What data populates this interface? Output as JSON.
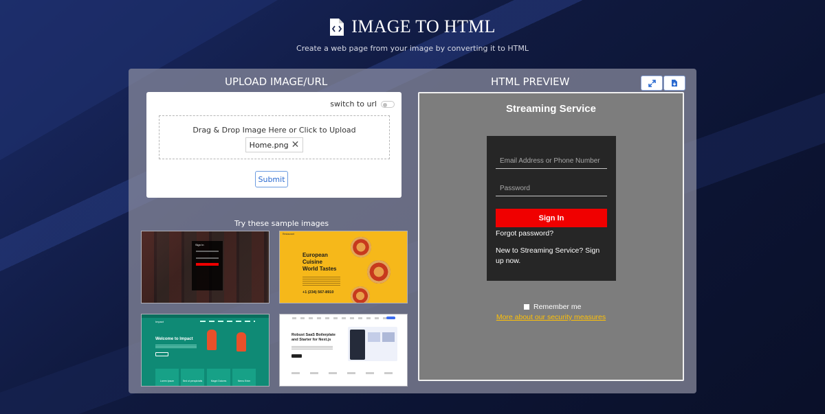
{
  "header": {
    "title": "IMAGE TO HTML",
    "subtitle": "Create a web page from your image by converting it to HTML"
  },
  "left": {
    "heading": "UPLOAD IMAGE/URL",
    "switch_label": "switch to url",
    "drop_text": "Drag & Drop Image Here or Click to Upload",
    "file_name": "Home.png",
    "submit_label": "Submit",
    "samples_label": "Try these sample images",
    "samples": [
      {
        "name": "streaming-login",
        "text": "Sign In"
      },
      {
        "name": "european-cuisine",
        "heading_line1": "European",
        "heading_line2": "Cuisine",
        "heading_line3": "World Tastes",
        "phone": "+1 (234) 567-8910",
        "logo": "Restaurant"
      },
      {
        "name": "impact",
        "brand": "Impact",
        "heading": "Welcome to Impact",
        "cards": [
          "Lorem Ipsum",
          "Sed ut perspiciatis",
          "Magni Dolores",
          "Nemo Enim"
        ]
      },
      {
        "name": "saas",
        "heading_line1": "Robust SaaS Boilerplate",
        "heading_line2": "and Starter for Next.js"
      }
    ]
  },
  "right": {
    "heading": "HTML PREVIEW",
    "preview": {
      "title": "Streaming Service",
      "email_placeholder": "Email Address or Phone Number",
      "password_placeholder": "Password",
      "signin_label": "Sign In",
      "forgot": "Forgot password?",
      "new_to": "New to Streaming Service? Sign up now.",
      "remember": "Remember me",
      "security_link": "More about our security measures"
    }
  },
  "colors": {
    "accent": "#2a6ad0",
    "signin": "#f00000",
    "link": "#ffc107",
    "panel": "#8c8ea0"
  }
}
